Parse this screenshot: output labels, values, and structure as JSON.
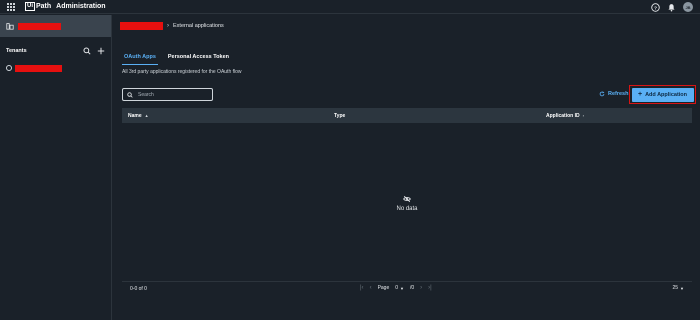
{
  "header": {
    "logo_box": "Ui",
    "logo_text": "Path",
    "title": "Administration",
    "avatar_initials": "JB"
  },
  "sidebar": {
    "section_title": "Tenants"
  },
  "breadcrumb": {
    "current": "External applications"
  },
  "tabs": [
    {
      "label": "OAuth Apps",
      "active": true
    },
    {
      "label": "Personal Access Token",
      "active": false
    }
  ],
  "description": "All 3rd party applications registered for the OAuth flow",
  "search": {
    "placeholder": "Search"
  },
  "actions": {
    "refresh_label": "Refresh",
    "add_label": "Add Application"
  },
  "table": {
    "columns": [
      "Name",
      "Type",
      "Application ID"
    ],
    "empty_text": "No data"
  },
  "pagination": {
    "range": "0-0 of 0",
    "page_label": "Page",
    "page_value": "0",
    "page_total": "/0",
    "per_page": "25"
  },
  "colors": {
    "accent": "#5ab0f5",
    "background": "#1a2129",
    "redaction": "#e6100f",
    "highlight_border": "#d81414"
  }
}
